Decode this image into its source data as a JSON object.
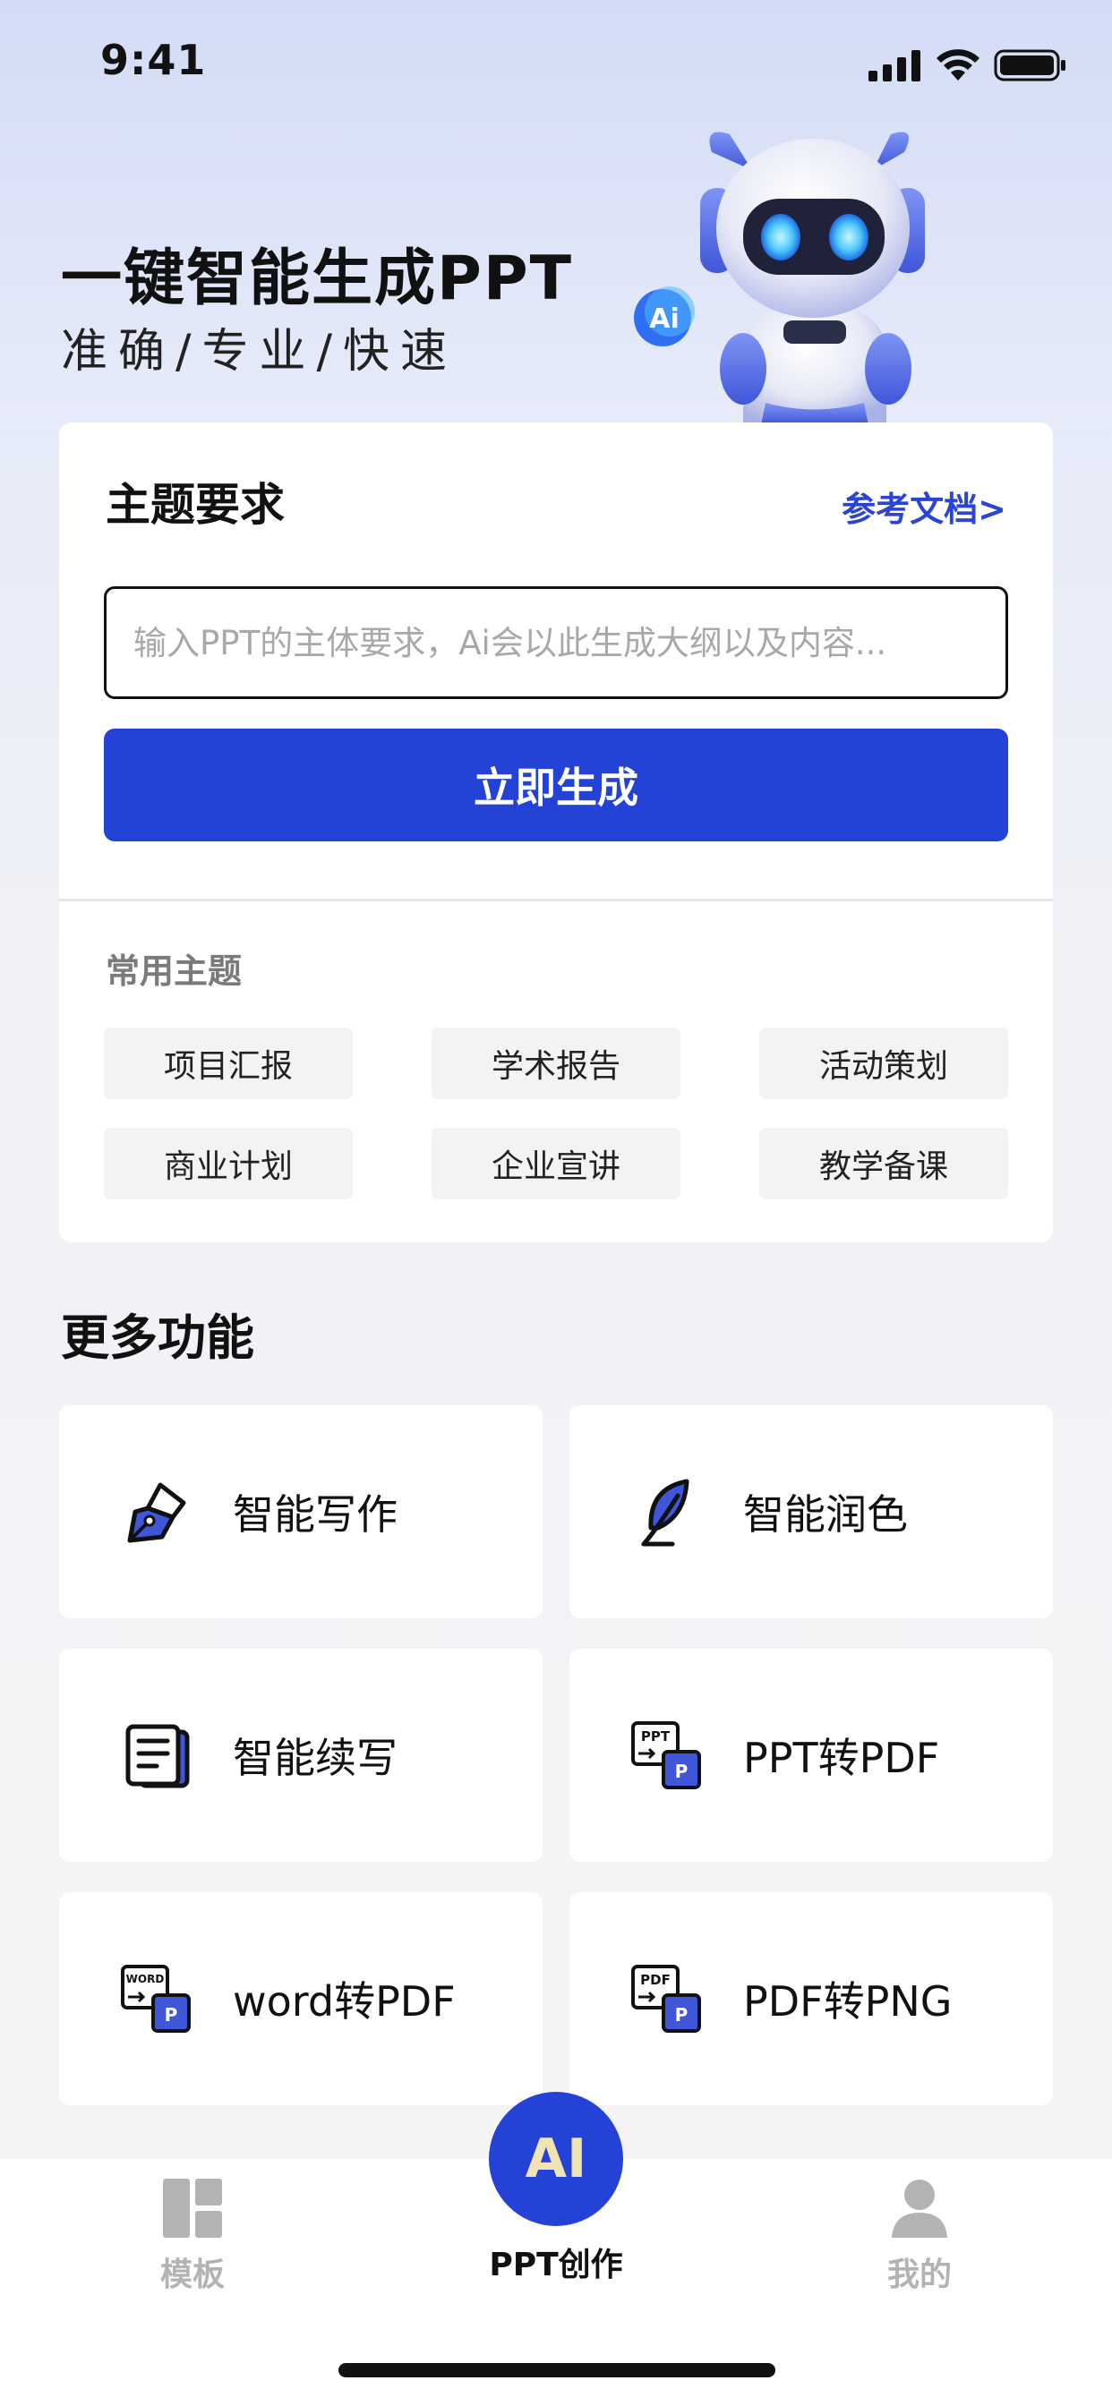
{
  "status_bar": {
    "time": "9:41"
  },
  "hero": {
    "title": "一键智能生成PPT",
    "subtitle": "准确/专业/快速",
    "badge": "Ai"
  },
  "main_card": {
    "title": "主题要求",
    "reference_link": "参考文档>",
    "input_placeholder": "输入PPT的主体要求，Ai会以此生成大纲以及内容...",
    "generate_button": "立即生成",
    "common_topics_label": "常用主题",
    "topics": [
      "项目汇报",
      "学术报告",
      "活动策划",
      "商业计划",
      "企业宣讲",
      "教学备课"
    ]
  },
  "more_features": {
    "title": "更多功能",
    "items": [
      {
        "label": "智能写作",
        "icon": "pen-nib-icon"
      },
      {
        "label": "智能润色",
        "icon": "feather-icon"
      },
      {
        "label": "智能续写",
        "icon": "document-icon"
      },
      {
        "label": "PPT转PDF",
        "icon": "ppt-to-pdf-icon",
        "icon_text": "PPT"
      },
      {
        "label": "word转PDF",
        "icon": "word-to-pdf-icon",
        "icon_text": "WORD"
      },
      {
        "label": "PDF转PNG",
        "icon": "pdf-to-png-icon",
        "icon_text": "PDF"
      }
    ]
  },
  "tab_bar": {
    "templates": "模板",
    "create": "PPT创作",
    "create_badge": "AI",
    "mine": "我的"
  },
  "colors": {
    "accent": "#2443d6",
    "link": "#2a44d4",
    "inactive_tab": "#b3b3b3"
  }
}
